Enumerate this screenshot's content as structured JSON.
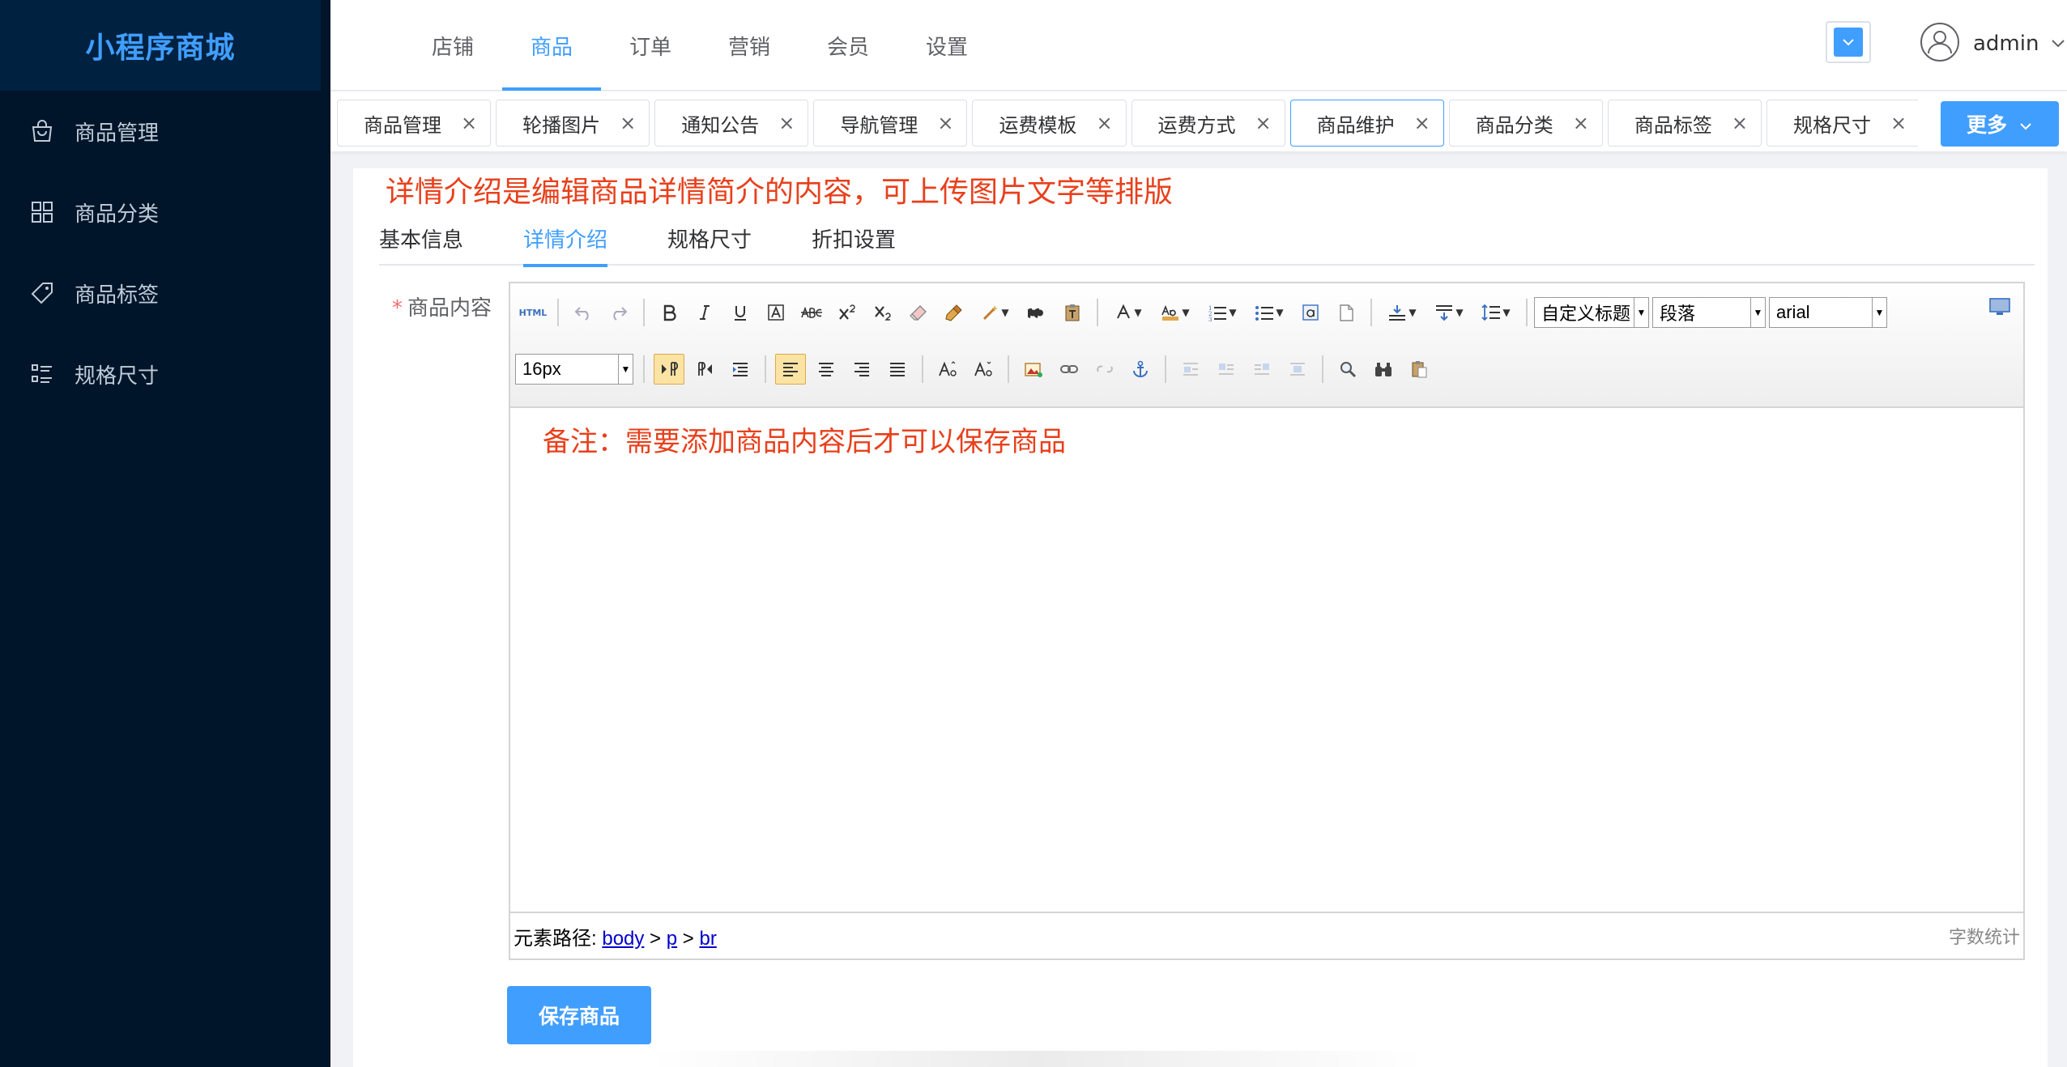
{
  "app": {
    "logo_text": "小程序商城"
  },
  "sidebar": {
    "items": [
      {
        "label": "商品管理",
        "icon": "shopping-bag-icon"
      },
      {
        "label": "商品分类",
        "icon": "category-grid-icon"
      },
      {
        "label": "商品标签",
        "icon": "tag-icon"
      },
      {
        "label": "规格尺寸",
        "icon": "spec-list-icon"
      }
    ]
  },
  "header": {
    "nav": [
      "店铺",
      "商品",
      "订单",
      "营销",
      "会员",
      "设置"
    ],
    "active_nav": "商品",
    "user_name": "admin"
  },
  "tags_bar": {
    "tags": [
      "商品管理",
      "轮播图片",
      "通知公告",
      "导航管理",
      "运费模板",
      "运费方式",
      "商品维护",
      "商品分类",
      "商品标签",
      "规格尺寸"
    ],
    "active_tag": "商品维护",
    "close_glyph": "×",
    "more_label": "更多"
  },
  "page": {
    "annotation": "详情介绍是编辑商品详情简介的内容，可上传图片文字等排版",
    "tabs": [
      "基本信息",
      "详情介绍",
      "规格尺寸",
      "折扣设置"
    ],
    "active_tab": "详情介绍",
    "field_label": "商品内容",
    "required_mark": "*"
  },
  "editor": {
    "toolbar": {
      "html_label": "HTML",
      "title_select": "自定义标题",
      "paragraph_select": "段落",
      "font_select": "arial",
      "size_select": "16px"
    },
    "content_note": "备注：需要添加商品内容后才可以保存商品",
    "status": {
      "path_label": "元素路径:",
      "path": [
        "body",
        "p",
        "br"
      ],
      "word_count_label": "字数统计"
    }
  },
  "actions": {
    "save_label": "保存商品"
  },
  "colors": {
    "sidebar_bg": "#001529",
    "accent": "#409eff",
    "annotation": "#e8401c"
  }
}
